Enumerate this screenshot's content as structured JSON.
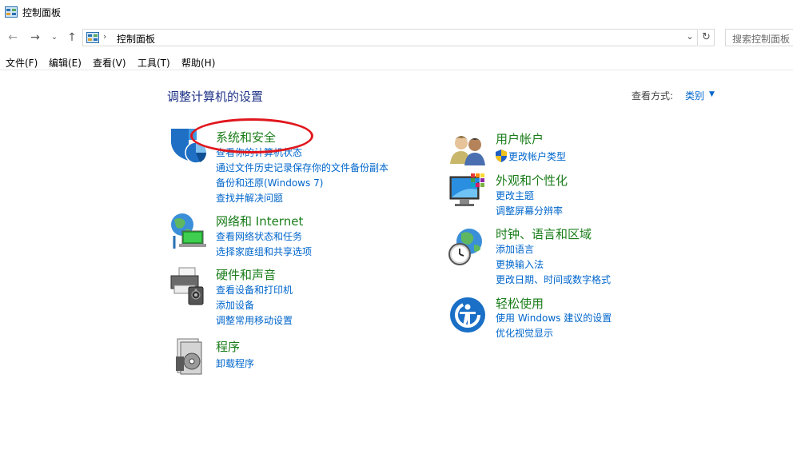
{
  "window": {
    "title": "控制面板",
    "icon": "control-panel-icon"
  },
  "navbar": {
    "back_icon": "←",
    "forward_icon": "→",
    "recent_icon": "⌄",
    "up_icon": "↑",
    "address_separator": "›",
    "address_path": "控制面板",
    "dropdown_icon": "⌄",
    "refresh_icon": "↻",
    "search_placeholder": "搜索控制面板"
  },
  "menu": {
    "file": "文件(F)",
    "edit": "编辑(E)",
    "view": "查看(V)",
    "tools": "工具(T)",
    "help": "帮助(H)"
  },
  "header": {
    "title": "调整计算机的设置",
    "view_by_label": "查看方式:",
    "view_by_value": "类别",
    "view_by_arrow": "▼"
  },
  "categories": {
    "system_security": {
      "title": "系统和安全",
      "icon": "shield-icon",
      "links": [
        "查看你的计算机状态",
        "通过文件历史记录保存你的文件备份副本",
        "备份和还原(Windows 7)",
        "查找并解决问题"
      ]
    },
    "network": {
      "title": "网络和 Internet",
      "icon": "network-icon",
      "links": [
        "查看网络状态和任务",
        "选择家庭组和共享选项"
      ]
    },
    "hardware": {
      "title": "硬件和声音",
      "icon": "printer-icon",
      "links": [
        "查看设备和打印机",
        "添加设备",
        "调整常用移动设置"
      ]
    },
    "programs": {
      "title": "程序",
      "icon": "programs-icon",
      "links": [
        "卸载程序"
      ]
    },
    "user_accounts": {
      "title": "用户帐户",
      "icon": "users-icon",
      "links": [
        "更改帐户类型"
      ]
    },
    "appearance": {
      "title": "外观和个性化",
      "icon": "monitor-icon",
      "links": [
        "更改主题",
        "调整屏幕分辨率"
      ]
    },
    "clock_region": {
      "title": "时钟、语言和区域",
      "icon": "clock-globe-icon",
      "links": [
        "添加语言",
        "更换输入法",
        "更改日期、时间或数字格式"
      ]
    },
    "ease_access": {
      "title": "轻松使用",
      "icon": "ease-of-access-icon",
      "links": [
        "使用 Windows 建议的设置",
        "优化视觉显示"
      ]
    }
  },
  "colors": {
    "category_title": "#1a7d1a",
    "link": "#0066cc",
    "header_title": "#1e3287",
    "annotation": "#e0171d"
  }
}
